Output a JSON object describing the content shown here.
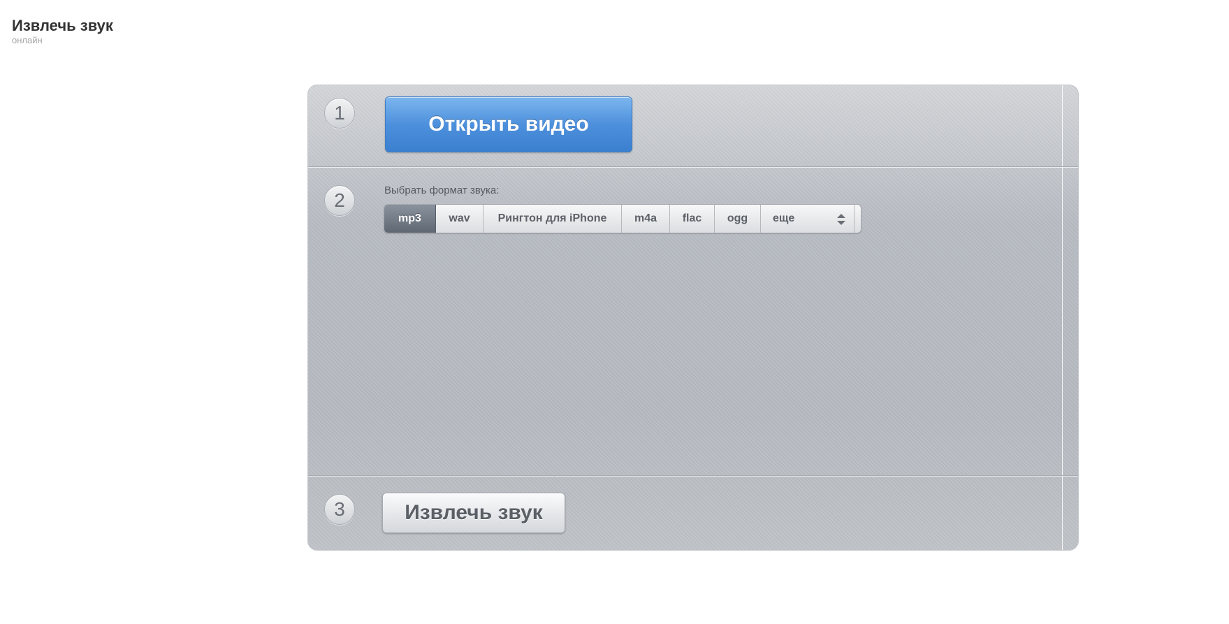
{
  "header": {
    "title": "Извлечь звук",
    "subtitle": "онлайн"
  },
  "steps": {
    "step1": {
      "number": "1",
      "button_label": "Открыть видео"
    },
    "step2": {
      "number": "2",
      "label": "Выбрать формат звука:",
      "formats": [
        "mp3",
        "wav",
        "Рингтон для iPhone",
        "m4a",
        "flac",
        "ogg"
      ],
      "more_label": "еще",
      "selected": "mp3"
    },
    "step3": {
      "number": "3",
      "button_label": "Извлечь звук"
    }
  },
  "colors": {
    "accent_blue": "#4d90dc",
    "selected_format": "#6b737e",
    "panel": "#b8bcc3"
  },
  "icons": {
    "more_dropdown": "updown-arrows-icon"
  }
}
